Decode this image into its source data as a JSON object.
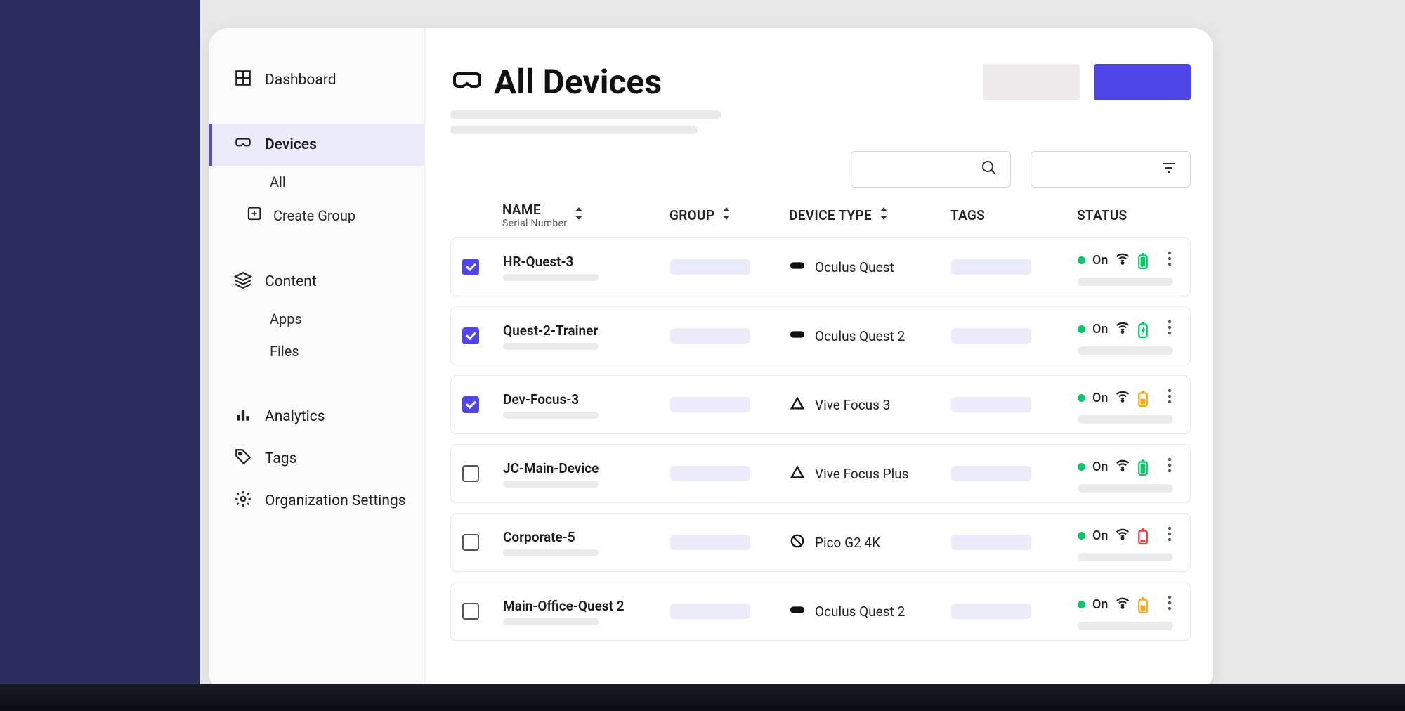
{
  "sidebar": {
    "dashboard": "Dashboard",
    "devices": "Devices",
    "devices_all": "All",
    "devices_create_group": "Create Group",
    "content": "Content",
    "content_apps": "Apps",
    "content_files": "Files",
    "analytics": "Analytics",
    "tags": "Tags",
    "org_settings": "Organization Settings"
  },
  "page": {
    "title": "All Devices"
  },
  "columns": {
    "name": "NAME",
    "name_sub": "Serial Number",
    "group": "GROUP",
    "device_type": "DEVICE TYPE",
    "tags": "TAGS",
    "status": "STATUS"
  },
  "status_labels": {
    "on": "On"
  },
  "devices": [
    {
      "name": "HR-Quest-3",
      "checked": true,
      "type": "Oculus Quest",
      "type_icon": "oculus",
      "status": "On",
      "battery": "full-green"
    },
    {
      "name": "Quest-2-Trainer",
      "checked": true,
      "type": "Oculus Quest 2",
      "type_icon": "oculus",
      "status": "On",
      "battery": "charging-green"
    },
    {
      "name": "Dev-Focus-3",
      "checked": true,
      "type": "Vive Focus 3",
      "type_icon": "vive",
      "status": "On",
      "battery": "half-orange"
    },
    {
      "name": "JC-Main-Device",
      "checked": false,
      "type": "Vive Focus Plus",
      "type_icon": "vive",
      "status": "On",
      "battery": "full-green"
    },
    {
      "name": "Corporate-5",
      "checked": false,
      "type": "Pico G2 4K",
      "type_icon": "pico",
      "status": "On",
      "battery": "low-red"
    },
    {
      "name": "Main-Office-Quest 2",
      "checked": false,
      "type": "Oculus Quest 2",
      "type_icon": "oculus",
      "status": "On",
      "battery": "half-orange"
    }
  ],
  "colors": {
    "accent": "#5046e5",
    "green": "#0ec36a",
    "orange": "#f5a623",
    "red": "#e23d3d"
  }
}
